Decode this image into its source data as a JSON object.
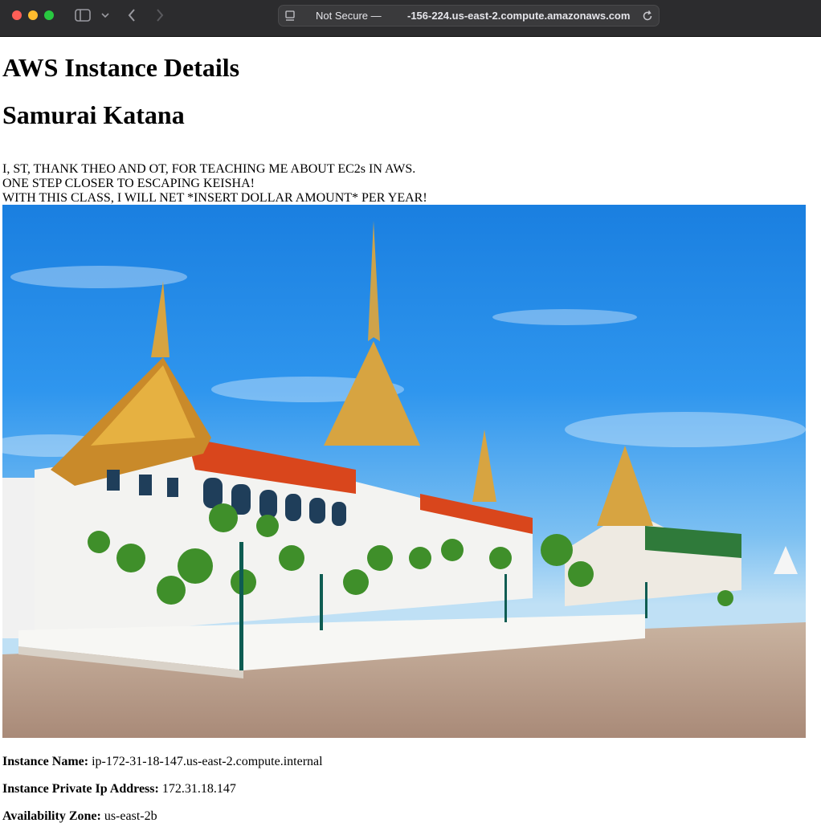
{
  "browser": {
    "address_security": "Not Secure —",
    "address_url": "-156-224.us-east-2.compute.amazonaws.com"
  },
  "page": {
    "heading": "AWS Instance Details",
    "subheading": "Samurai Katana",
    "message_lines": [
      "I, ST, THANK THEO AND OT, FOR TEACHING ME ABOUT EC2s IN AWS.",
      "ONE STEP CLOSER TO ESCAPING KEISHA!",
      "WITH THIS CLASS, I WILL NET *INSERT DOLLAR AMOUNT* PER YEAR!"
    ],
    "image": "grand-palace-bangkok-photo",
    "details": [
      {
        "label": "Instance Name:",
        "value": "ip-172-31-18-147.us-east-2.compute.internal"
      },
      {
        "label": "Instance Private Ip Address:",
        "value": "172.31.18.147"
      },
      {
        "label": "Availability Zone:",
        "value": "us-east-2b"
      }
    ]
  }
}
